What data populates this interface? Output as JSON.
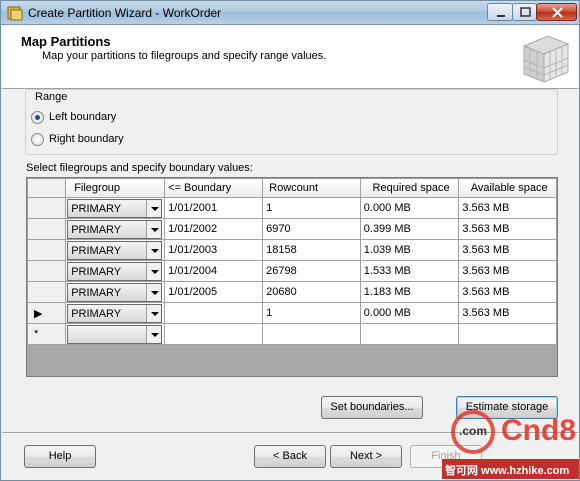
{
  "window": {
    "title": "Create Partition Wizard - WorkOrder"
  },
  "header": {
    "title": "Map Partitions",
    "subtitle": "Map your partitions to filegroups and specify range values."
  },
  "range": {
    "label": "Range",
    "options": [
      {
        "label": "Left boundary",
        "selected": true
      },
      {
        "label": "Right boundary",
        "selected": false
      }
    ]
  },
  "grid": {
    "label": "Select filegroups and specify boundary values:",
    "columns": [
      "Filegroup",
      "<= Boundary",
      "Rowcount",
      "Required space",
      "Available space"
    ],
    "rows": [
      {
        "marker": "",
        "filegroup": "PRIMARY",
        "boundary": "1/01/2001",
        "rowcount": "1",
        "required": "0.000 MB",
        "available": "3.563 MB"
      },
      {
        "marker": "",
        "filegroup": "PRIMARY",
        "boundary": "1/01/2002",
        "rowcount": "6970",
        "required": "0.399 MB",
        "available": "3.563 MB"
      },
      {
        "marker": "",
        "filegroup": "PRIMARY",
        "boundary": "1/01/2003",
        "rowcount": "18158",
        "required": "1.039 MB",
        "available": "3.563 MB"
      },
      {
        "marker": "",
        "filegroup": "PRIMARY",
        "boundary": "1/01/2004",
        "rowcount": "26798",
        "required": "1.533 MB",
        "available": "3.563 MB"
      },
      {
        "marker": "",
        "filegroup": "PRIMARY",
        "boundary": "1/01/2005",
        "rowcount": "20680",
        "required": "1.183 MB",
        "available": "3.563 MB"
      },
      {
        "marker": "▶",
        "filegroup": "PRIMARY",
        "boundary": "",
        "rowcount": "1",
        "required": "0.000 MB",
        "available": "3.563 MB"
      },
      {
        "marker": "*",
        "filegroup": "",
        "boundary": "",
        "rowcount": "",
        "required": "",
        "available": ""
      }
    ]
  },
  "buttons": {
    "set_boundaries": "Set boundaries...",
    "estimate_storage": "Estimate storage",
    "help": "Help",
    "back": "< Back",
    "next": "Next >",
    "finish": "Finish"
  },
  "watermark": {
    "brand": "Cnd8",
    "domain": ".com",
    "footer": "智可网 www.hzhike.com"
  },
  "colors": {
    "close_button": "#c9462c",
    "watermark": "#e03020"
  }
}
